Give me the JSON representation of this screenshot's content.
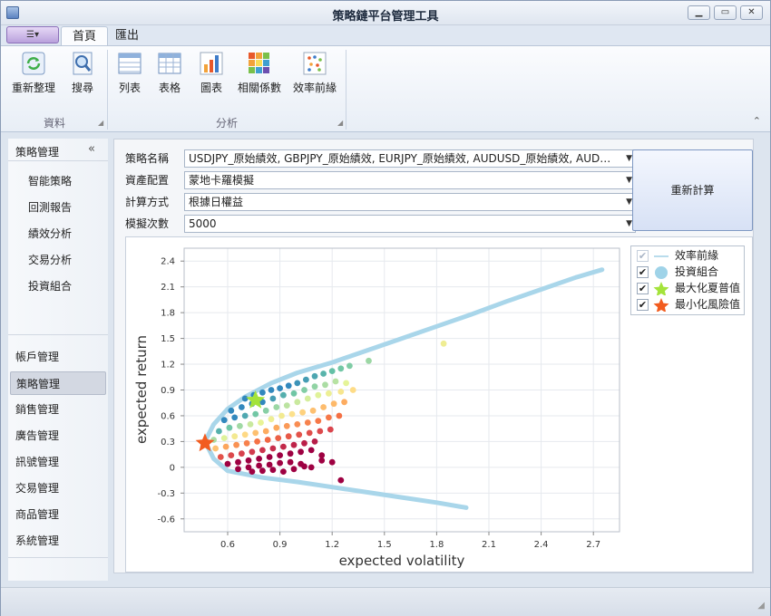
{
  "window": {
    "title": "策略鏈平台管理工具",
    "min_label": "▁",
    "max_label": "▭",
    "close_label": "✕"
  },
  "ribbon": {
    "app_menu_label": "☰▾",
    "tabs": [
      {
        "label": "首頁"
      },
      {
        "label": "匯出"
      }
    ],
    "buttons": [
      {
        "label": "重新整理",
        "icon": "refresh-icon"
      },
      {
        "label": "搜尋",
        "icon": "search-icon"
      },
      {
        "label": "列表",
        "icon": "list-icon"
      },
      {
        "label": "表格",
        "icon": "table-icon"
      },
      {
        "label": "圖表",
        "icon": "bar-chart-icon"
      },
      {
        "label": "相關係數",
        "icon": "heatmap-icon"
      },
      {
        "label": "效率前緣",
        "icon": "scatter-icon"
      }
    ],
    "groups": [
      {
        "label": "資料"
      },
      {
        "label": "分析"
      }
    ],
    "collapse_icon": "⌃"
  },
  "sidebar": {
    "header": "策略管理",
    "collapse_icon": "«",
    "subitems": [
      {
        "label": "智能策略"
      },
      {
        "label": "回測報告"
      },
      {
        "label": "績效分析"
      },
      {
        "label": "交易分析"
      },
      {
        "label": "投資組合"
      }
    ],
    "nav": [
      {
        "label": "帳戶管理"
      },
      {
        "label": "策略管理"
      },
      {
        "label": "銷售管理"
      },
      {
        "label": "廣告管理"
      },
      {
        "label": "訊號管理"
      },
      {
        "label": "交易管理"
      },
      {
        "label": "商品管理"
      },
      {
        "label": "系統管理"
      }
    ],
    "selected": "策略管理"
  },
  "form": {
    "strategy_label": "策略名稱",
    "strategy_value": "USDJPY_原始績效, GBPJPY_原始績效, EURJPY_原始績效, AUDUSD_原始績效, AUDN...",
    "alloc_label": "資產配置",
    "alloc_value": "蒙地卡羅模擬",
    "calc_label": "計算方式",
    "calc_value": "根據日權益",
    "sims_label": "模擬次數",
    "sims_value": "5000",
    "recalc_button": "重新計算"
  },
  "legend": {
    "items": [
      {
        "label": "效率前緣",
        "color": "#9fd3e8",
        "checked": true,
        "disabled": true
      },
      {
        "label": "投資組合",
        "color": "#9fd3e8",
        "checked": true
      },
      {
        "label": "最大化夏普值",
        "color": "#a4e33b",
        "checked": true
      },
      {
        "label": "最小化風險值",
        "color": "#f25c1f",
        "checked": true
      }
    ]
  },
  "chart_data": {
    "type": "scatter",
    "xlabel": "expected volatility",
    "ylabel": "expected return",
    "xlim": [
      0.35,
      2.85
    ],
    "ylim": [
      -0.75,
      2.55
    ],
    "x_ticks": [
      0.6,
      0.9,
      1.2,
      1.5,
      1.8,
      2.1,
      2.4,
      2.7
    ],
    "y_ticks": [
      -0.6,
      -0.3,
      0,
      0.3,
      0.6,
      0.9,
      1.2,
      1.5,
      1.8,
      2.1,
      2.4
    ],
    "grid": true,
    "legend_position": "top-right",
    "frontier": {
      "upper": [
        [
          0.47,
          0.3
        ],
        [
          0.52,
          0.5
        ],
        [
          0.6,
          0.68
        ],
        [
          0.7,
          0.82
        ],
        [
          0.85,
          0.98
        ],
        [
          1.0,
          1.1
        ],
        [
          1.2,
          1.22
        ],
        [
          1.4,
          1.36
        ],
        [
          1.6,
          1.5
        ],
        [
          1.8,
          1.64
        ],
        [
          2.0,
          1.78
        ],
        [
          2.2,
          1.93
        ],
        [
          2.4,
          2.07
        ],
        [
          2.6,
          2.21
        ],
        [
          2.75,
          2.3
        ]
      ],
      "lower": [
        [
          0.47,
          0.3
        ],
        [
          0.52,
          0.1
        ],
        [
          0.6,
          -0.04
        ],
        [
          0.8,
          -0.12
        ],
        [
          1.0,
          -0.17
        ],
        [
          1.2,
          -0.23
        ],
        [
          1.4,
          -0.29
        ],
        [
          1.6,
          -0.35
        ],
        [
          1.8,
          -0.41
        ],
        [
          1.97,
          -0.47
        ]
      ]
    },
    "portfolios": [
      [
        0.7,
        0.8
      ],
      [
        0.75,
        0.84
      ],
      [
        0.8,
        0.87
      ],
      [
        0.85,
        0.9
      ],
      [
        0.9,
        0.92
      ],
      [
        0.95,
        0.95
      ],
      [
        1.0,
        0.98
      ],
      [
        1.05,
        1.02
      ],
      [
        1.1,
        1.06
      ],
      [
        1.15,
        1.09
      ],
      [
        1.2,
        1.12
      ],
      [
        1.25,
        1.15
      ],
      [
        1.3,
        1.18
      ],
      [
        1.41,
        1.24
      ],
      [
        0.62,
        0.66
      ],
      [
        0.68,
        0.7
      ],
      [
        0.74,
        0.74
      ],
      [
        0.8,
        0.76
      ],
      [
        0.86,
        0.8
      ],
      [
        0.92,
        0.84
      ],
      [
        0.98,
        0.86
      ],
      [
        1.04,
        0.9
      ],
      [
        1.1,
        0.94
      ],
      [
        1.16,
        0.96
      ],
      [
        1.22,
        1.0
      ],
      [
        1.28,
        0.98
      ],
      [
        0.58,
        0.55
      ],
      [
        0.64,
        0.58
      ],
      [
        0.7,
        0.6
      ],
      [
        0.76,
        0.62
      ],
      [
        0.82,
        0.66
      ],
      [
        0.88,
        0.7
      ],
      [
        0.94,
        0.72
      ],
      [
        1.0,
        0.76
      ],
      [
        1.06,
        0.8
      ],
      [
        1.12,
        0.84
      ],
      [
        1.18,
        0.86
      ],
      [
        1.25,
        0.88
      ],
      [
        1.32,
        0.9
      ],
      [
        0.55,
        0.42
      ],
      [
        0.61,
        0.46
      ],
      [
        0.67,
        0.48
      ],
      [
        0.73,
        0.5
      ],
      [
        0.79,
        0.52
      ],
      [
        0.85,
        0.56
      ],
      [
        0.91,
        0.6
      ],
      [
        0.97,
        0.62
      ],
      [
        1.03,
        0.64
      ],
      [
        1.09,
        0.66
      ],
      [
        1.15,
        0.7
      ],
      [
        1.21,
        0.74
      ],
      [
        1.27,
        0.76
      ],
      [
        0.52,
        0.32
      ],
      [
        0.58,
        0.34
      ],
      [
        0.64,
        0.36
      ],
      [
        0.7,
        0.38
      ],
      [
        0.76,
        0.4
      ],
      [
        0.82,
        0.42
      ],
      [
        0.88,
        0.46
      ],
      [
        0.94,
        0.48
      ],
      [
        1.0,
        0.5
      ],
      [
        1.06,
        0.52
      ],
      [
        1.12,
        0.54
      ],
      [
        1.18,
        0.58
      ],
      [
        1.24,
        0.6
      ],
      [
        0.53,
        0.22
      ],
      [
        0.59,
        0.24
      ],
      [
        0.65,
        0.26
      ],
      [
        0.71,
        0.28
      ],
      [
        0.77,
        0.3
      ],
      [
        0.83,
        0.32
      ],
      [
        0.89,
        0.34
      ],
      [
        0.95,
        0.36
      ],
      [
        1.01,
        0.38
      ],
      [
        1.07,
        0.4
      ],
      [
        1.13,
        0.42
      ],
      [
        1.19,
        0.44
      ],
      [
        0.56,
        0.12
      ],
      [
        0.62,
        0.14
      ],
      [
        0.68,
        0.16
      ],
      [
        0.74,
        0.18
      ],
      [
        0.8,
        0.2
      ],
      [
        0.86,
        0.22
      ],
      [
        0.92,
        0.24
      ],
      [
        0.98,
        0.26
      ],
      [
        1.04,
        0.28
      ],
      [
        1.1,
        0.3
      ],
      [
        0.6,
        0.04
      ],
      [
        0.66,
        0.06
      ],
      [
        0.72,
        0.08
      ],
      [
        0.78,
        0.1
      ],
      [
        0.84,
        0.12
      ],
      [
        0.9,
        0.14
      ],
      [
        0.96,
        0.16
      ],
      [
        1.02,
        0.18
      ],
      [
        1.08,
        0.2
      ],
      [
        1.14,
        0.14
      ],
      [
        1.2,
        0.06
      ],
      [
        0.66,
        -0.02
      ],
      [
        0.72,
        0.0
      ],
      [
        0.78,
        0.02
      ],
      [
        0.84,
        0.03
      ],
      [
        0.9,
        0.05
      ],
      [
        0.96,
        0.06
      ],
      [
        1.02,
        0.04
      ],
      [
        1.08,
        0.0
      ],
      [
        1.14,
        0.08
      ],
      [
        0.74,
        -0.05
      ],
      [
        0.8,
        -0.04
      ],
      [
        0.86,
        -0.03
      ],
      [
        0.92,
        -0.05
      ],
      [
        0.98,
        -0.02
      ],
      [
        1.04,
        0.01
      ],
      [
        1.84,
        1.44
      ],
      [
        1.25,
        -0.15
      ]
    ],
    "max_sharpe": [
      0.76,
      0.78
    ],
    "min_risk": [
      0.47,
      0.28
    ]
  }
}
